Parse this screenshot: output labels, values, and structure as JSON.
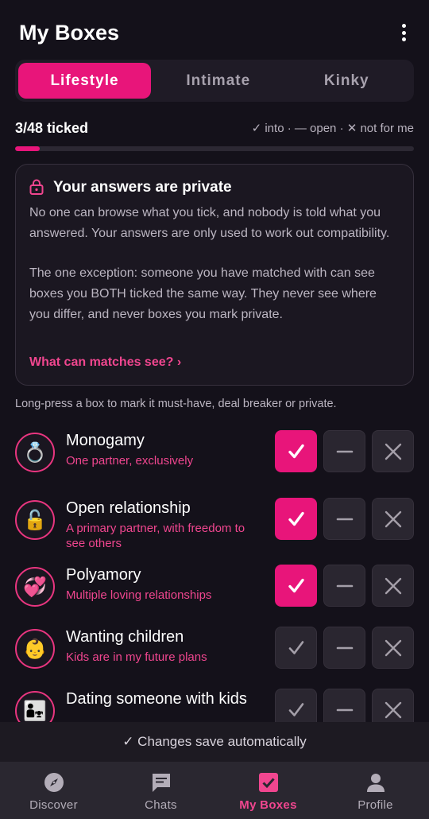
{
  "header": {
    "title": "My Boxes",
    "menu_icon": "more-vertical-icon"
  },
  "tabs": [
    {
      "label": "Lifestyle",
      "active": true
    },
    {
      "label": "Intimate",
      "active": false
    },
    {
      "label": "Kinky",
      "active": false
    }
  ],
  "progress": {
    "ticked_label": "3/48 ticked",
    "ticked": 3,
    "total": 48,
    "legend": "✓ into · — open · ✕ not for me"
  },
  "privacy": {
    "icon": "lock-icon",
    "title": "Your answers are private",
    "para1": "No one can browse what you tick, and nobody is told what you answered. Your answers are only used to work out compatibility.",
    "para2": "The one exception: someone you have matched with can see boxes you BOTH ticked the same way. They never see where you differ, and never boxes you mark private.",
    "link": "What can matches see? ›"
  },
  "hint": "Long-press a box to mark it must-have, deal breaker or private.",
  "boxes": [
    {
      "title": "Monogamy",
      "subtitle": "One partner, exclusively",
      "icon": "💍",
      "icon_name": "ring-icon",
      "selected": "into"
    },
    {
      "title": "Open relationship",
      "subtitle": "A primary partner, with freedom to see others",
      "icon": "🔓",
      "icon_name": "unlocked-padlock-icon",
      "selected": "into"
    },
    {
      "title": "Polyamory",
      "subtitle": "Multiple loving relationships",
      "icon": "💞",
      "icon_name": "revolving-hearts-icon",
      "selected": "into"
    },
    {
      "title": "Wanting children",
      "subtitle": "Kids are in my future plans",
      "icon": "👶",
      "icon_name": "baby-icon",
      "selected": "none"
    },
    {
      "title": "Dating someone with kids",
      "subtitle": "",
      "icon": "👨‍👧",
      "icon_name": "family-icon",
      "selected": "none"
    }
  ],
  "save_note": "✓ Changes save automatically",
  "nav": [
    {
      "label": "Discover",
      "icon": "compass-icon",
      "active": false
    },
    {
      "label": "Chats",
      "icon": "chat-bubble-icon",
      "active": false
    },
    {
      "label": "My Boxes",
      "icon": "checkbox-icon",
      "active": true
    },
    {
      "label": "Profile",
      "icon": "person-icon",
      "active": false
    }
  ],
  "colors": {
    "accent": "#e8157a",
    "accent_text": "#f0468f",
    "background": "#14111a",
    "card": "#1b1721"
  }
}
